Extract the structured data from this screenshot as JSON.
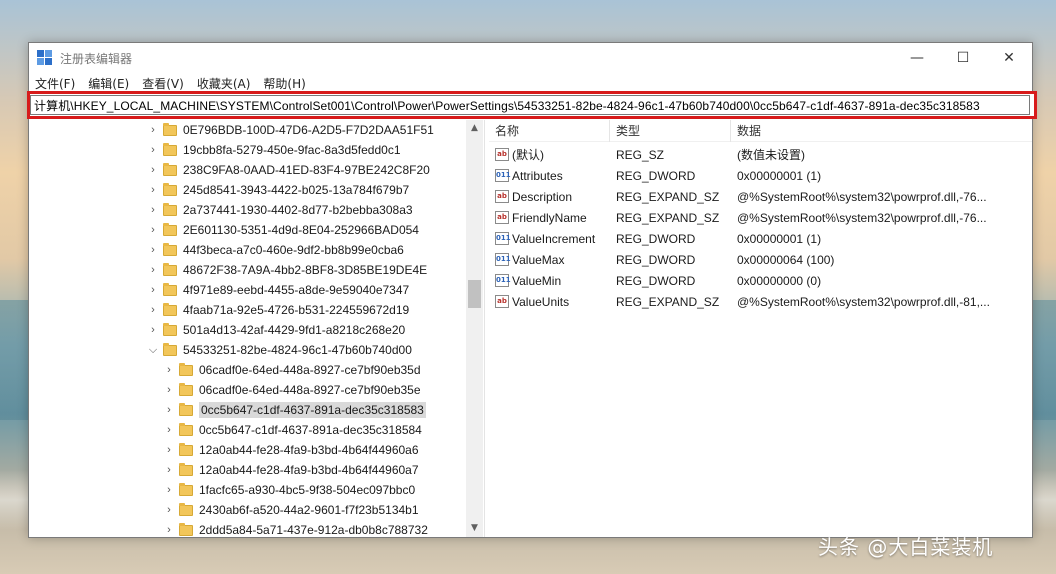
{
  "window": {
    "title": "注册表编辑器",
    "minimize_label": "—",
    "maximize_label": "☐",
    "close_label": "✕"
  },
  "menu": [
    "文件(F)",
    "编辑(E)",
    "查看(V)",
    "收藏夹(A)",
    "帮助(H)"
  ],
  "address": {
    "path": "计算机\\HKEY_LOCAL_MACHINE\\SYSTEM\\ControlSet001\\Control\\Power\\PowerSettings\\54533251-82be-4824-96c1-47b60b740d00\\0cc5b647-c1df-4637-891a-dec35c318583",
    "highlight_color": "#d71b1b"
  },
  "tree": {
    "items": [
      {
        "label": "0E796BDB-100D-47D6-A2D5-F7D2DAA51F51",
        "level": 0,
        "expand": "collapsed"
      },
      {
        "label": "19cbb8fa-5279-450e-9fac-8a3d5fedd0c1",
        "level": 0,
        "expand": "collapsed"
      },
      {
        "label": "238C9FA8-0AAD-41ED-83F4-97BE242C8F20",
        "level": 0,
        "expand": "collapsed"
      },
      {
        "label": "245d8541-3943-4422-b025-13a784f679b7",
        "level": 0,
        "expand": "collapsed"
      },
      {
        "label": "2a737441-1930-4402-8d77-b2bebba308a3",
        "level": 0,
        "expand": "collapsed"
      },
      {
        "label": "2E601130-5351-4d9d-8E04-252966BAD054",
        "level": 0,
        "expand": "collapsed"
      },
      {
        "label": "44f3beca-a7c0-460e-9df2-bb8b99e0cba6",
        "level": 0,
        "expand": "collapsed"
      },
      {
        "label": "48672F38-7A9A-4bb2-8BF8-3D85BE19DE4E",
        "level": 0,
        "expand": "collapsed"
      },
      {
        "label": "4f971e89-eebd-4455-a8de-9e59040e7347",
        "level": 0,
        "expand": "collapsed"
      },
      {
        "label": "4faab71a-92e5-4726-b531-224559672d19",
        "level": 0,
        "expand": "collapsed"
      },
      {
        "label": "501a4d13-42af-4429-9fd1-a8218c268e20",
        "level": 0,
        "expand": "collapsed"
      },
      {
        "label": "54533251-82be-4824-96c1-47b60b740d00",
        "level": 0,
        "expand": "expanded"
      },
      {
        "label": "06cadf0e-64ed-448a-8927-ce7bf90eb35d",
        "level": 1,
        "expand": "collapsed"
      },
      {
        "label": "06cadf0e-64ed-448a-8927-ce7bf90eb35e",
        "level": 1,
        "expand": "collapsed"
      },
      {
        "label": "0cc5b647-c1df-4637-891a-dec35c318583",
        "level": 1,
        "expand": "collapsed",
        "selected": true
      },
      {
        "label": "0cc5b647-c1df-4637-891a-dec35c318584",
        "level": 1,
        "expand": "collapsed"
      },
      {
        "label": "12a0ab44-fe28-4fa9-b3bd-4b64f44960a6",
        "level": 1,
        "expand": "collapsed"
      },
      {
        "label": "12a0ab44-fe28-4fa9-b3bd-4b64f44960a7",
        "level": 1,
        "expand": "collapsed"
      },
      {
        "label": "1facfc65-a930-4bc5-9f38-504ec097bbc0",
        "level": 1,
        "expand": "collapsed"
      },
      {
        "label": "2430ab6f-a520-44a2-9601-f7f23b5134b1",
        "level": 1,
        "expand": "collapsed"
      },
      {
        "label": "2ddd5a84-5a71-437e-912a-db0b8c788732",
        "level": 1,
        "expand": "collapsed"
      }
    ]
  },
  "list": {
    "headers": {
      "name": "名称",
      "type": "类型",
      "data": "数据"
    },
    "rows": [
      {
        "icon": "string-value-icon",
        "icon_glyph": "ab",
        "name": "(默认)",
        "type": "REG_SZ",
        "data": "(数值未设置)"
      },
      {
        "icon": "binary-value-icon",
        "icon_glyph": "011",
        "name": "Attributes",
        "type": "REG_DWORD",
        "data": "0x00000001 (1)"
      },
      {
        "icon": "string-value-icon",
        "icon_glyph": "ab",
        "name": "Description",
        "type": "REG_EXPAND_SZ",
        "data": "@%SystemRoot%\\system32\\powrprof.dll,-76..."
      },
      {
        "icon": "string-value-icon",
        "icon_glyph": "ab",
        "name": "FriendlyName",
        "type": "REG_EXPAND_SZ",
        "data": "@%SystemRoot%\\system32\\powrprof.dll,-76..."
      },
      {
        "icon": "binary-value-icon",
        "icon_glyph": "011",
        "name": "ValueIncrement",
        "type": "REG_DWORD",
        "data": "0x00000001 (1)"
      },
      {
        "icon": "binary-value-icon",
        "icon_glyph": "011",
        "name": "ValueMax",
        "type": "REG_DWORD",
        "data": "0x00000064 (100)"
      },
      {
        "icon": "binary-value-icon",
        "icon_glyph": "011",
        "name": "ValueMin",
        "type": "REG_DWORD",
        "data": "0x00000000 (0)"
      },
      {
        "icon": "string-value-icon",
        "icon_glyph": "ab",
        "name": "ValueUnits",
        "type": "REG_EXPAND_SZ",
        "data": "@%SystemRoot%\\system32\\powrprof.dll,-81,..."
      }
    ]
  },
  "watermark": "头条 @大白菜装机"
}
